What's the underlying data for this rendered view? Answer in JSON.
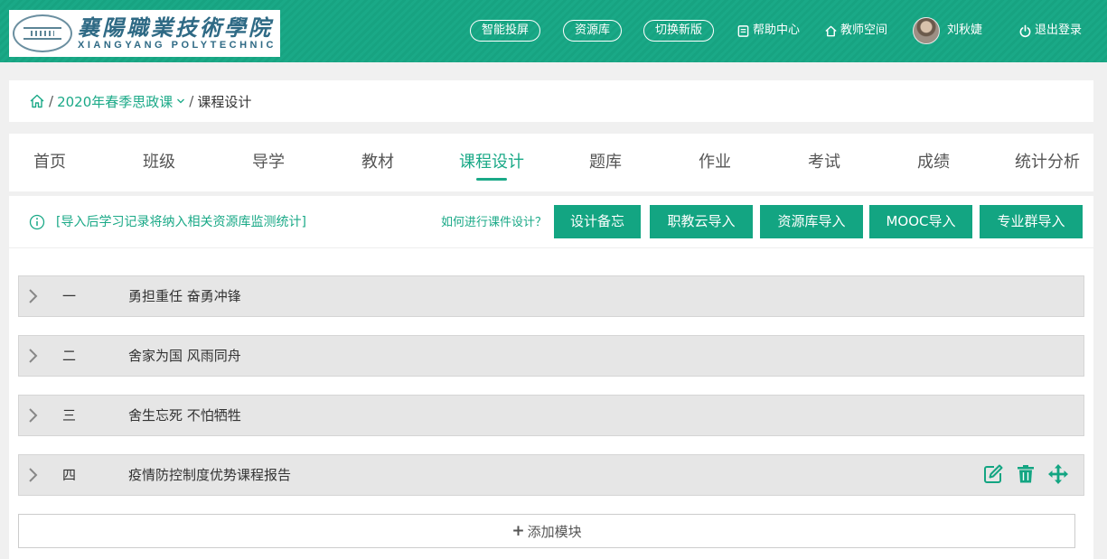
{
  "header": {
    "logo": {
      "cn": "襄陽職業技術學院",
      "en": "XIANGYANG POLYTECHNIC"
    },
    "pill_buttons": [
      "智能投屏",
      "资源库",
      "切换新版"
    ],
    "links": {
      "help": "帮助中心",
      "teacher_space": "教师空间",
      "logout": "退出登录"
    },
    "user_name": "刘秋婕"
  },
  "breadcrumb": {
    "sep": "/",
    "course": "2020年春季思政课",
    "current": "课程设计"
  },
  "tabs": [
    "首页",
    "班级",
    "导学",
    "教材",
    "课程设计",
    "题库",
    "作业",
    "考试",
    "成绩",
    "统计分析"
  ],
  "active_tab": "课程设计",
  "infobar": {
    "notice": "[导入后学习记录将纳入相关资源库监测统计]",
    "howto": "如何进行课件设计？",
    "buttons": [
      "设计备忘",
      "职教云导入",
      "资源库导入",
      "MOOC导入",
      "专业群导入"
    ]
  },
  "modules": [
    {
      "num": "一",
      "title": "勇担重任 奋勇冲锋"
    },
    {
      "num": "二",
      "title": "舍家为国 风雨同舟"
    },
    {
      "num": "三",
      "title": "舍生忘死 不怕牺牲"
    },
    {
      "num": "四",
      "title": "疫情防控制度优势课程报告"
    }
  ],
  "add_module_label": "添加模块",
  "colors": {
    "accent": "#1aa987",
    "button": "#13a582",
    "module_bg": "#e6e6e6"
  }
}
